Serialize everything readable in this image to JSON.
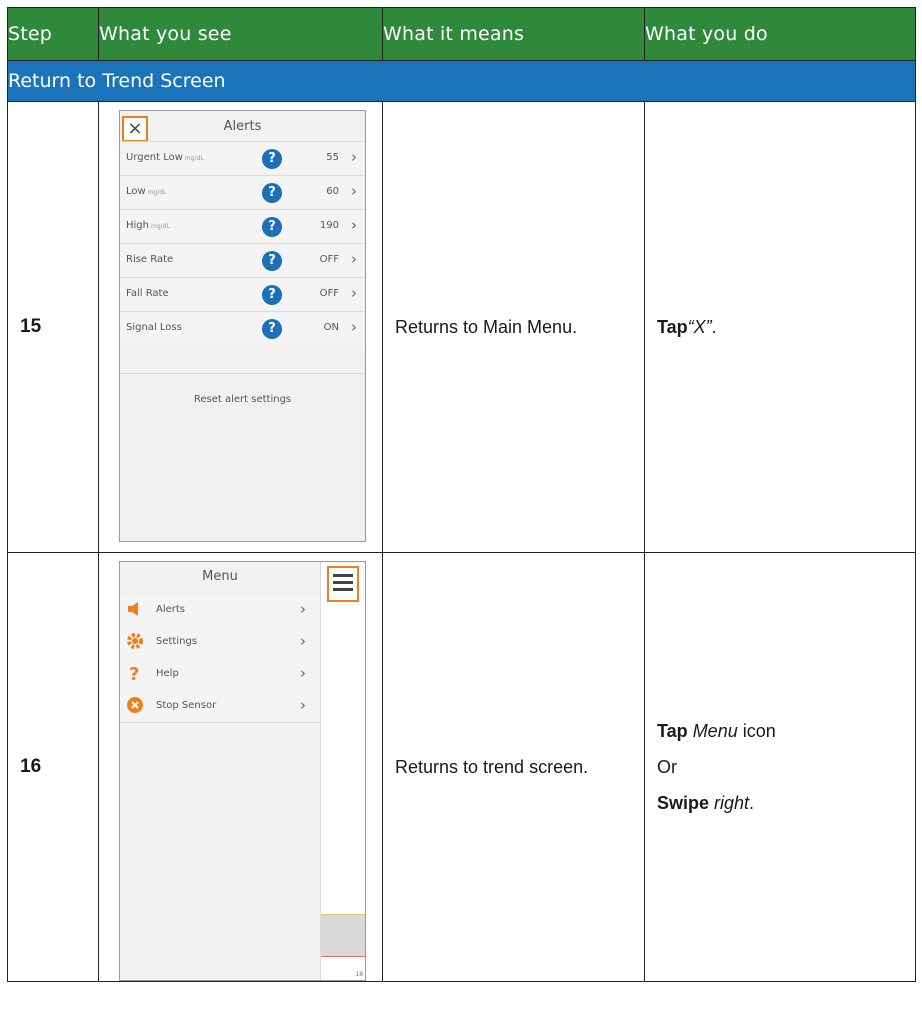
{
  "header": {
    "step": "Step",
    "see": "What you see",
    "means": "What it means",
    "do": "What you do"
  },
  "section_title": "Return to Trend Screen",
  "row15": {
    "step": "15",
    "means": "Returns to Main Menu.",
    "do_bold": "Tap",
    "do_italic": "“X”",
    "do_end": ".",
    "screen": {
      "close_glyph": "×",
      "title": "Alerts",
      "alerts": [
        {
          "label": "Urgent Low",
          "unit": "mg/dL",
          "value": "55"
        },
        {
          "label": "Low",
          "unit": "mg/dL",
          "value": "60"
        },
        {
          "label": "High",
          "unit": "mg/dL",
          "value": "190"
        },
        {
          "label": "Rise Rate",
          "unit": "",
          "value": "OFF"
        },
        {
          "label": "Fall Rate",
          "unit": "",
          "value": "OFF"
        },
        {
          "label": "Signal Loss",
          "unit": "",
          "value": "ON"
        }
      ],
      "help_glyph": "?",
      "chevron": "›",
      "reset": "Reset alert settings"
    }
  },
  "row16": {
    "step": "16",
    "means": "Returns to trend screen.",
    "do_line1_bold": "Tap",
    "do_line1_italic": "Menu",
    "do_line1_end": "icon",
    "do_line2": "Or",
    "do_line3_bold": "Swipe",
    "do_line3_italic": "right",
    "do_line3_end": ".",
    "screen": {
      "title": "Menu",
      "items": [
        {
          "label": "Alerts",
          "icon": "speaker-icon",
          "color": "#f07f1a"
        },
        {
          "label": "Settings",
          "icon": "gear-icon",
          "color": "#f07f1a"
        },
        {
          "label": "Help",
          "icon": "question-icon",
          "color": "#f07f1a"
        },
        {
          "label": "Stop Sensor",
          "icon": "stop-icon",
          "color": "#f07f1a"
        }
      ],
      "chevron": "›",
      "axis_tick": "18"
    }
  },
  "colors": {
    "header_green": "#2e8a3a",
    "section_blue": "#1b74ba",
    "highlight_orange": "#f07f1a",
    "help_blue": "#1d6fb8"
  }
}
